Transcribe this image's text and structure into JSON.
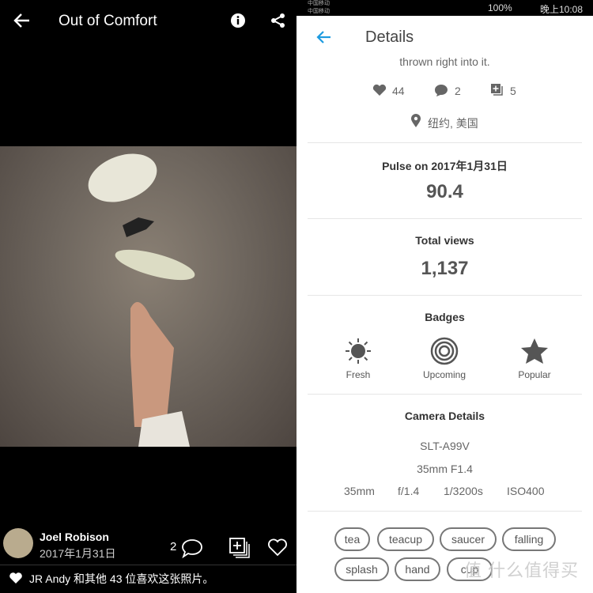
{
  "left": {
    "title": "Out of Comfort",
    "author": "Joel Robison",
    "date": "2017年1月31日",
    "comment_count": "2",
    "likes_text": "JR Andy 和其他 43 位喜欢这张照片。"
  },
  "status": {
    "carrier1": "中国移动",
    "carrier2": "中国移动",
    "battery": "100%",
    "time": "晚上10:08"
  },
  "details": {
    "title": "Details",
    "description_tail": "thrown right into it.",
    "likes": "44",
    "comments": "2",
    "galleries": "5",
    "location": "纽约, 美国",
    "pulse_label": "Pulse on 2017年1月31日",
    "pulse": "90.4",
    "views_label": "Total views",
    "views": "1,137",
    "badges_label": "Badges",
    "badges": [
      "Fresh",
      "Upcoming",
      "Popular"
    ],
    "camera_label": "Camera Details",
    "camera": "SLT-A99V",
    "lens": "35mm F1.4",
    "focal": "35mm",
    "aperture": "f/1.4",
    "shutter": "1/3200s",
    "iso": "ISO400",
    "tags": [
      "tea",
      "teacup",
      "saucer",
      "falling",
      "splash",
      "hand",
      "cup"
    ]
  },
  "watermark": "值 什么值得买",
  "colors": {
    "accent": "#1e9be0"
  }
}
